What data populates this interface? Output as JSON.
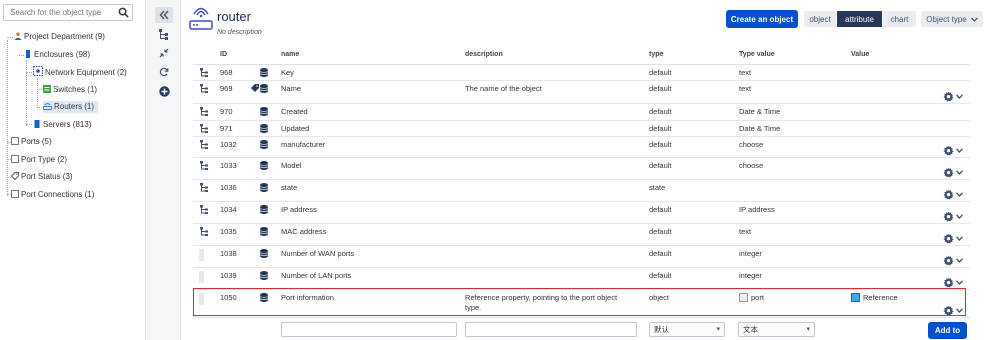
{
  "sidebar": {
    "search_placeholder": "Search for the object type",
    "items": [
      {
        "label": "Project Department (9)",
        "icon": "person-icon",
        "color": "#d9822b"
      },
      {
        "label": "Enclosures (98)",
        "icon": "rack-icon",
        "color": "#1565c0"
      },
      {
        "label": "Network Equipment (2)",
        "icon": "network-icon",
        "color": "#3949ab"
      },
      {
        "label": "Switches (1)",
        "icon": "switch-icon",
        "color": "#43a047"
      },
      {
        "label": "Routers (1)",
        "icon": "router-icon",
        "color": "#1e88e5"
      },
      {
        "label": "Servers (813)",
        "icon": "server-icon",
        "color": "#1565c0"
      },
      {
        "label": "Ports (5)",
        "icon": "port-icon",
        "color": "#777"
      },
      {
        "label": "Port Type (2)",
        "icon": "port-icon",
        "color": "#777"
      },
      {
        "label": "Port Status (3)",
        "icon": "tag-icon",
        "color": "#555"
      },
      {
        "label": "Port Connections (1)",
        "icon": "port-icon",
        "color": "#777"
      }
    ]
  },
  "header": {
    "title": "router",
    "subtitle": "No description",
    "create_button": "Create an object",
    "tabs": [
      "object",
      "attribute",
      "chart"
    ],
    "active_tab": "attribute",
    "object_type_button": "Object type"
  },
  "table": {
    "columns": [
      "ID",
      "name",
      "description",
      "type",
      "Type value",
      "Value"
    ],
    "rows": [
      {
        "id": "968",
        "name": "Key",
        "description": "",
        "type": "default",
        "type_value": "text",
        "value": "",
        "gear": false
      },
      {
        "id": "969",
        "name": "Name",
        "description": "The name of the object",
        "type": "default",
        "type_value": "text",
        "value": "",
        "gear": true
      },
      {
        "id": "970",
        "name": "Created",
        "description": "",
        "type": "default",
        "type_value": "Date & Time",
        "value": "",
        "gear": false
      },
      {
        "id": "971",
        "name": "Updated",
        "description": "",
        "type": "default",
        "type_value": "Date & Time",
        "value": "",
        "gear": false
      },
      {
        "id": "1032",
        "name": "manufacturer",
        "description": "",
        "type": "default",
        "type_value": "choose",
        "value": "",
        "gear": true
      },
      {
        "id": "1033",
        "name": "Model",
        "description": "",
        "type": "default",
        "type_value": "choose",
        "value": "",
        "gear": true
      },
      {
        "id": "1036",
        "name": "state",
        "description": "",
        "type": "state",
        "type_value": "",
        "value": "",
        "gear": true
      },
      {
        "id": "1034",
        "name": "IP address",
        "description": "",
        "type": "default",
        "type_value": "IP address",
        "value": "",
        "gear": true
      },
      {
        "id": "1035",
        "name": "MAC address",
        "description": "",
        "type": "default",
        "type_value": "text",
        "value": "",
        "gear": true
      },
      {
        "id": "1038",
        "name": "Number of WAN ports",
        "description": "",
        "type": "default",
        "type_value": "integer",
        "value": "",
        "gear": true
      },
      {
        "id": "1039",
        "name": "Number of LAN ports",
        "description": "",
        "type": "default",
        "type_value": "integer",
        "value": "",
        "gear": true
      },
      {
        "id": "1050",
        "name": "Port information",
        "description": "Reference property, pointing to the port object type.",
        "type": "object",
        "type_value": "port",
        "value": "Reference",
        "gear": true
      }
    ]
  },
  "add_row": {
    "type_select": "默认",
    "value_select": "文本",
    "add_button": "Add to"
  },
  "colors": {
    "primary": "#0052cc",
    "active_tab": "#253858",
    "highlight": "#d32f2f",
    "reference_chip": "#42a5f5"
  }
}
